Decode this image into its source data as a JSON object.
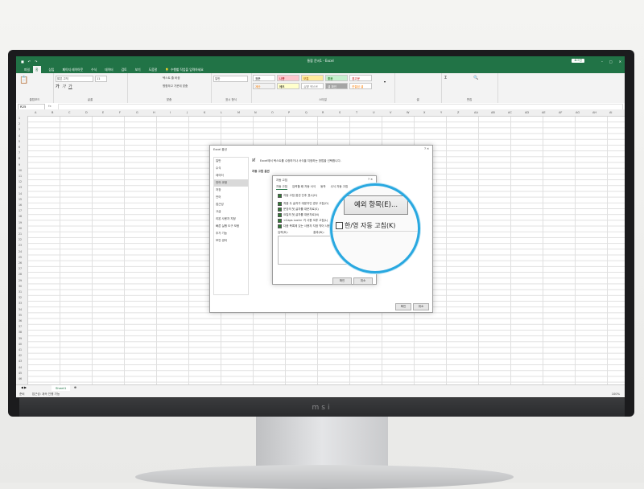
{
  "excel": {
    "title": "통합 문서1 - Excel",
    "signin": "로그인",
    "tabs": [
      "파일",
      "홈",
      "삽입",
      "페이지 레이아웃",
      "수식",
      "데이터",
      "검토",
      "보기",
      "도움말"
    ],
    "search_hint": "수행할 작업을 입력하세요",
    "font_name": "맑은 고딕",
    "font_size": "11",
    "number_format": "일반",
    "wrap_text": "텍스트 줄 바꿈",
    "merge_center": "병합하고 가운데 맞춤",
    "group_labels": [
      "클립보드",
      "글꼴",
      "맞춤",
      "표시 형식",
      "스타일",
      "셀",
      "편집"
    ],
    "cell_styles": [
      "표준",
      "나쁨",
      "보통",
      "좋음",
      "경고문",
      "계산",
      "메모",
      "설명 텍스트",
      "셀 확인",
      "연결된 셀"
    ],
    "name_box": "R25",
    "sheet_tab": "Sheet1",
    "status_left": "준비",
    "status_access": "접근성: 계속 진행 가능",
    "zoom": "100%",
    "columns": [
      "A",
      "B",
      "C",
      "D",
      "E",
      "F",
      "G",
      "H",
      "I",
      "J",
      "K",
      "L",
      "M",
      "N",
      "O",
      "P",
      "Q",
      "R",
      "S",
      "T",
      "U",
      "V",
      "W",
      "X",
      "Y",
      "Z",
      "AA",
      "AB",
      "AC",
      "AD",
      "AE",
      "AF",
      "AG",
      "AH",
      "AI"
    ]
  },
  "options_dialog": {
    "title": "Excel 옵션",
    "heading": "Excel에서 텍스트를 수정하거나 서식을 지정하는 방법을 선택합니다.",
    "section": "자동 고침 옵션",
    "sidebar": [
      "일반",
      "수식",
      "데이터",
      "언어 교정",
      "저장",
      "언어",
      "접근성",
      "고급",
      "리본 사용자 지정",
      "빠른 실행 도구 모음",
      "추가 기능",
      "보안 센터"
    ],
    "ok": "확인",
    "cancel": "취소"
  },
  "autocorrect_dialog": {
    "title": "자동 고침",
    "tabs": [
      "자동 고침",
      "입력할 때 자동 서식",
      "동작",
      "수식 자동 고침"
    ],
    "show_buttons": "자동 고침 옵션 단추 표시(H)",
    "checks": [
      "처음 두 글자가 대문자인 경우 고침(O)",
      "문장의 첫 글자를 대문자로(S)",
      "요일의 첫 글자를 대문자로(N)",
      "<Caps Lock> 키 사용 오류 고침(L)",
      "다음 목록에 있는 사용자 지정 약어 사용(T)"
    ],
    "col_input": "입력(R):",
    "col_result": "결과(W):",
    "ok": "확인",
    "cancel": "취소"
  },
  "magnifier": {
    "exceptions_button": "예외 항목(E)...",
    "korean_english": "한/영 자동 고침(K)"
  }
}
